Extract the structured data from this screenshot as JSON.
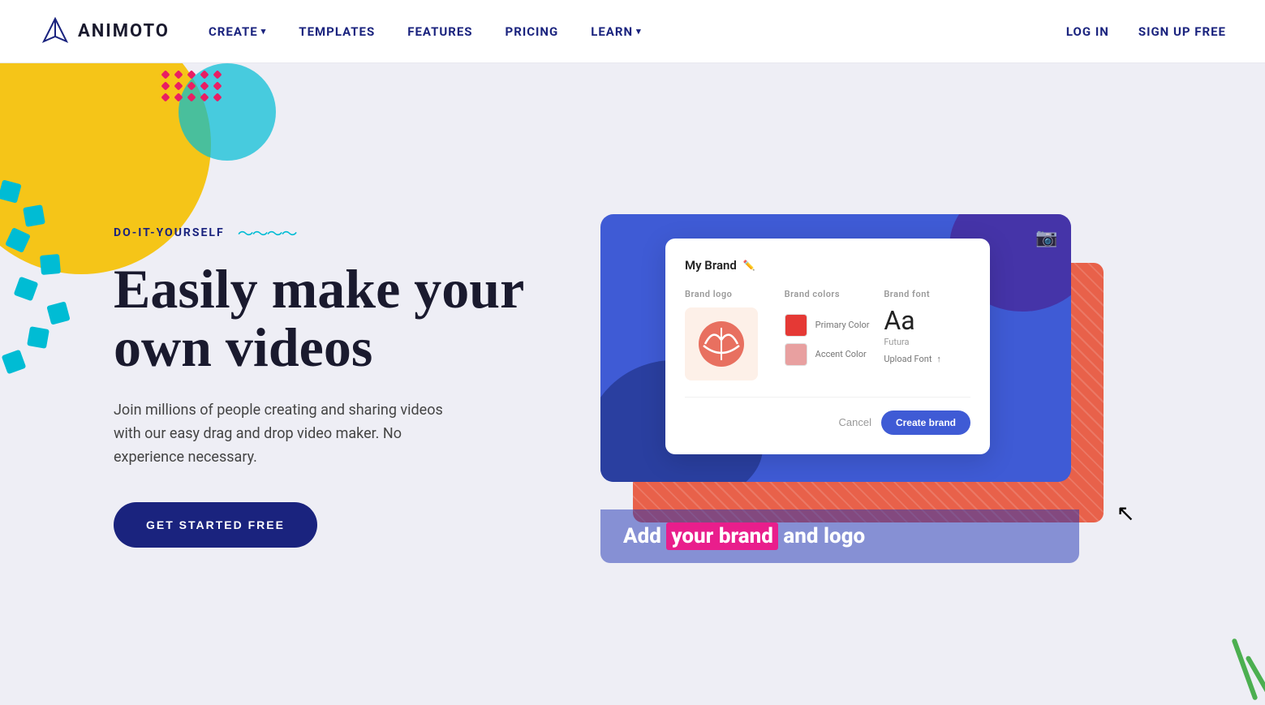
{
  "nav": {
    "logo_text": "ANIMOTO",
    "links": [
      {
        "label": "CREATE",
        "has_dropdown": true
      },
      {
        "label": "TEMPLATES",
        "has_dropdown": false
      },
      {
        "label": "FEATURES",
        "has_dropdown": false
      },
      {
        "label": "PRICING",
        "has_dropdown": false
      },
      {
        "label": "LEARN",
        "has_dropdown": true
      }
    ],
    "login_label": "LOG IN",
    "signup_label": "SIGN UP FREE"
  },
  "hero": {
    "tag": "DO-IT-YOURSELF",
    "title_line1": "Easily make your",
    "title_line2": "own videos",
    "description": "Join millions of people creating and sharing videos with our easy drag and drop video maker. No experience necessary.",
    "cta_label": "GET STARTED FREE",
    "brand_panel": {
      "title": "My Brand",
      "brand_logo_label": "Brand logo",
      "brand_colors_label": "Brand colors",
      "brand_font_label": "Brand font",
      "primary_color_label": "Primary Color",
      "primary_color_hex": "#e53935",
      "accent_color_label": "Accent Color",
      "accent_color_hex": "#e8a0a0",
      "font_preview": "Aa",
      "font_name": "Futura",
      "upload_font_label": "Upload Font",
      "cancel_label": "Cancel",
      "create_brand_label": "Create brand"
    },
    "caption": {
      "prefix": "Add ",
      "highlight": "your brand",
      "suffix": " and logo"
    }
  }
}
